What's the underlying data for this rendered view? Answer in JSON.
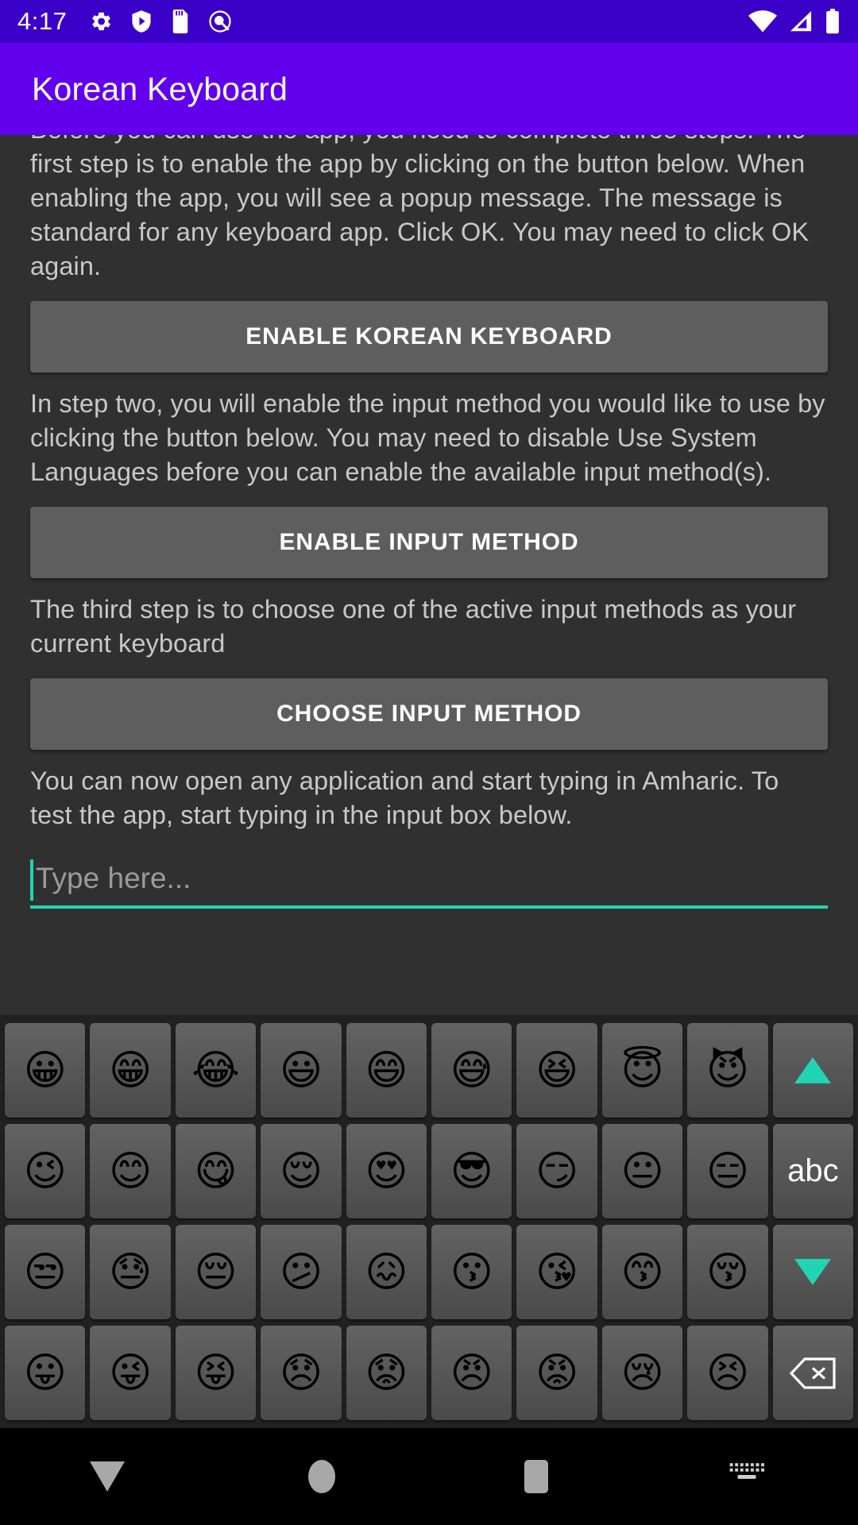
{
  "status_bar": {
    "time": "4:17",
    "left_icons": [
      "gear-icon",
      "play-protect-shield-icon",
      "sd-card-icon",
      "screen-record-icon"
    ],
    "right_icons": [
      "wifi-icon",
      "cellular-signal-off-icon",
      "battery-icon"
    ],
    "background_color": "#3b00c8"
  },
  "app_bar": {
    "title": "Korean Keyboard",
    "background_color": "#6200ee"
  },
  "content": {
    "paragraph_1": "Before you can use the app, you need to complete three steps. The first step is to enable the app by clicking on the button below. When enabling the app, you will see a popup message. The message is standard for any keyboard app. Click OK. You may need to click OK again.",
    "button_1": "ENABLE KOREAN KEYBOARD",
    "paragraph_2": "In step two, you will enable the input method you would like to use by clicking the button below. You may need to disable Use System Languages before you can enable the available input method(s).",
    "button_2": "ENABLE INPUT METHOD",
    "paragraph_3": "The third step is to choose one of the active input methods as your current keyboard",
    "button_3": "CHOOSE INPUT METHOD",
    "paragraph_4": "You can now open any application and start typing in Amharic. To test the app, start typing in the input box below.",
    "input": {
      "value": "",
      "placeholder": "Type here...",
      "accent_color": "#20d4b4"
    }
  },
  "keyboard": {
    "background_color": "#212121",
    "key_color": "#5a5a5a",
    "accent_color": "#20d4b4",
    "rows": [
      {
        "keys": [
          {
            "type": "emoji",
            "glyph": "😀",
            "name": "emoji-grinning-face"
          },
          {
            "type": "emoji",
            "glyph": "😁",
            "name": "emoji-beaming-face"
          },
          {
            "type": "emoji",
            "glyph": "😂",
            "name": "emoji-tears-of-joy"
          },
          {
            "type": "emoji",
            "glyph": "😃",
            "name": "emoji-grinning-big-eyes"
          },
          {
            "type": "emoji",
            "glyph": "😄",
            "name": "emoji-grinning-smiling-eyes"
          },
          {
            "type": "emoji",
            "glyph": "😅",
            "name": "emoji-grinning-sweat"
          },
          {
            "type": "emoji",
            "glyph": "😆",
            "name": "emoji-squinting-laugh"
          },
          {
            "type": "emoji",
            "glyph": "😇",
            "name": "emoji-halo"
          },
          {
            "type": "emoji",
            "glyph": "😈",
            "name": "emoji-smiling-imp"
          },
          {
            "type": "arrow-up",
            "glyph": "▲",
            "name": "page-up-key"
          }
        ]
      },
      {
        "keys": [
          {
            "type": "emoji",
            "glyph": "😉",
            "name": "emoji-winking-face"
          },
          {
            "type": "emoji",
            "glyph": "😊",
            "name": "emoji-smiling-blush"
          },
          {
            "type": "emoji",
            "glyph": "😋",
            "name": "emoji-yum"
          },
          {
            "type": "emoji",
            "glyph": "😌",
            "name": "emoji-relieved"
          },
          {
            "type": "emoji",
            "glyph": "😍",
            "name": "emoji-heart-eyes"
          },
          {
            "type": "emoji",
            "glyph": "😎",
            "name": "emoji-sunglasses"
          },
          {
            "type": "emoji",
            "glyph": "😏",
            "name": "emoji-smirk"
          },
          {
            "type": "emoji",
            "glyph": "😐",
            "name": "emoji-neutral-face"
          },
          {
            "type": "emoji",
            "glyph": "😑",
            "name": "emoji-expressionless"
          },
          {
            "type": "abc",
            "glyph": "abc",
            "name": "abc-switch-key"
          }
        ]
      },
      {
        "keys": [
          {
            "type": "emoji",
            "glyph": "😒",
            "name": "emoji-unamused"
          },
          {
            "type": "emoji",
            "glyph": "😓",
            "name": "emoji-downcast-sweat"
          },
          {
            "type": "emoji",
            "glyph": "😔",
            "name": "emoji-pensive"
          },
          {
            "type": "emoji",
            "glyph": "😕",
            "name": "emoji-confused"
          },
          {
            "type": "emoji",
            "glyph": "😖",
            "name": "emoji-confounded"
          },
          {
            "type": "emoji",
            "glyph": "😗",
            "name": "emoji-kissing"
          },
          {
            "type": "emoji",
            "glyph": "😘",
            "name": "emoji-kiss-heart"
          },
          {
            "type": "emoji",
            "glyph": "😙",
            "name": "emoji-kissing-smiling-eyes"
          },
          {
            "type": "emoji",
            "glyph": "😚",
            "name": "emoji-kissing-closed-eyes"
          },
          {
            "type": "arrow-down",
            "glyph": "▼",
            "name": "page-down-key"
          }
        ]
      },
      {
        "keys": [
          {
            "type": "emoji",
            "glyph": "😛",
            "name": "emoji-tongue-out"
          },
          {
            "type": "emoji",
            "glyph": "😜",
            "name": "emoji-winking-tongue"
          },
          {
            "type": "emoji",
            "glyph": "😝",
            "name": "emoji-squinting-tongue"
          },
          {
            "type": "emoji",
            "glyph": "😞",
            "name": "emoji-disappointed"
          },
          {
            "type": "emoji",
            "glyph": "😟",
            "name": "emoji-worried"
          },
          {
            "type": "emoji",
            "glyph": "😠",
            "name": "emoji-angry"
          },
          {
            "type": "emoji",
            "glyph": "😡",
            "name": "emoji-pouting-red"
          },
          {
            "type": "emoji",
            "glyph": "😢",
            "name": "emoji-crying"
          },
          {
            "type": "emoji",
            "glyph": "😣",
            "name": "emoji-persevering"
          },
          {
            "type": "backspace",
            "glyph": "⌫",
            "name": "backspace-key"
          }
        ]
      }
    ]
  },
  "nav_bar": {
    "items": [
      {
        "name": "nav-back-button",
        "icon": "back-triangle-icon"
      },
      {
        "name": "nav-home-button",
        "icon": "home-circle-icon"
      },
      {
        "name": "nav-recents-button",
        "icon": "recents-square-icon"
      },
      {
        "name": "nav-keyboard-switch-button",
        "icon": "keyboard-icon"
      }
    ]
  }
}
